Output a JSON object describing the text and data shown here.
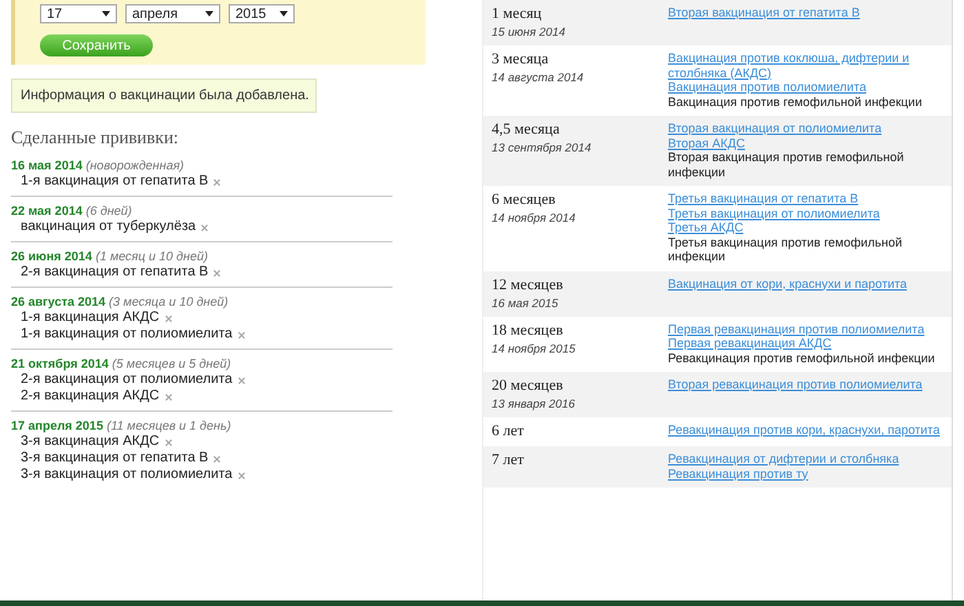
{
  "form": {
    "day": "17",
    "month": "апреля",
    "year": "2015",
    "save_button": "Сохранить"
  },
  "notice": "Информация о вакцинации была добавлена.",
  "done": {
    "title": "Сделанные прививки:",
    "groups": [
      {
        "date": "16 мая 2014",
        "age": "(новорожденная)",
        "items": [
          "1-я вакцинация от гепатита В"
        ]
      },
      {
        "date": "22 мая 2014",
        "age": "(6 дней)",
        "items": [
          "вакцинация от туберкулёза"
        ]
      },
      {
        "date": "26 июня 2014",
        "age": "(1 месяц и 10 дней)",
        "items": [
          "2-я вакцинация от гепатита В"
        ]
      },
      {
        "date": "26 августа 2014",
        "age": "(3 месяца и 10 дней)",
        "items": [
          "1-я вакцинация АКДС",
          "1-я вакцинация от полиомиелита"
        ]
      },
      {
        "date": "21 октября 2014",
        "age": "(5 месяцев и 5 дней)",
        "items": [
          "2-я вакцинация от полиомиелита",
          "2-я вакцинация АКДС"
        ]
      },
      {
        "date": "17 апреля 2015",
        "age": "(11 месяцев и 1 день)",
        "items": [
          "3-я вакцинация АКДС",
          "3-я вакцинация от гепатита В",
          "3-я вакцинация от полиомиелита"
        ]
      }
    ]
  },
  "schedule": [
    {
      "age": "1 месяц",
      "date": "15 июня 2014",
      "items": [
        {
          "kind": "link",
          "text": "Вторая вакцинация от гепатита В"
        }
      ]
    },
    {
      "age": "3 месяца",
      "date": "14 августа 2014",
      "items": [
        {
          "kind": "link",
          "text": "Вакцинация против коклюша, дифтерии и столбняка (АКДС)"
        },
        {
          "kind": "link",
          "text": "Вакцинация против полиомиелита"
        },
        {
          "kind": "text",
          "text": "Вакцинация против гемофильной инфекции"
        }
      ]
    },
    {
      "age": "4,5 месяца",
      "date": "13 сентября 2014",
      "items": [
        {
          "kind": "link",
          "text": "Вторая вакцинация от полиомиелита"
        },
        {
          "kind": "link",
          "text": "Вторая АКДС"
        },
        {
          "kind": "text",
          "text": "Вторая вакцинация против гемофильной инфекции"
        }
      ]
    },
    {
      "age": "6 месяцев",
      "date": "14 ноября 2014",
      "items": [
        {
          "kind": "link",
          "text": "Третья вакцинация от гепатита В"
        },
        {
          "kind": "link",
          "text": "Третья вакцинация от полиомиелита"
        },
        {
          "kind": "link",
          "text": "Третья АКДС"
        },
        {
          "kind": "text",
          "text": "Третья вакцинация против гемофильной инфекции"
        }
      ]
    },
    {
      "age": "12 месяцев",
      "date": "16 мая 2015",
      "items": [
        {
          "kind": "link",
          "text": "Вакцинация от кори, краснухи и паротита"
        }
      ]
    },
    {
      "age": "18 месяцев",
      "date": "14 ноября 2015",
      "items": [
        {
          "kind": "link",
          "text": "Первая ревакцинация против полиомиелита"
        },
        {
          "kind": "link",
          "text": "Первая ревакцинация АКДС"
        },
        {
          "kind": "text",
          "text": "Ревакцинация против гемофильной инфекции"
        }
      ]
    },
    {
      "age": "20 месяцев",
      "date": "13 января 2016",
      "items": [
        {
          "kind": "link",
          "text": "Вторая ревакцинация против полиомиелита"
        }
      ]
    },
    {
      "age": "6 лет",
      "items": [
        {
          "kind": "link",
          "text": "Ревакцинация против кори, краснухи, паротита"
        }
      ]
    },
    {
      "age": "7 лет",
      "items": [
        {
          "kind": "link",
          "text": "Ревакцинация от дифтерии и столбняка"
        },
        {
          "kind": "link",
          "text": "Ревакцинация против ту"
        }
      ]
    }
  ]
}
